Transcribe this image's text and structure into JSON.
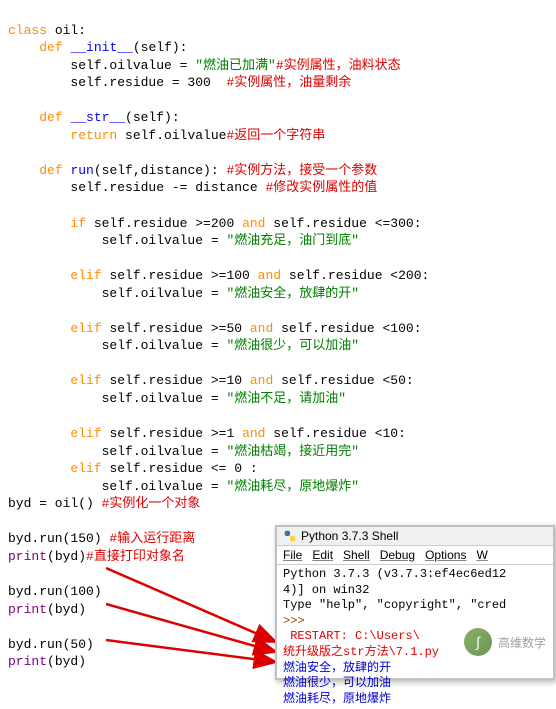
{
  "code": {
    "l1_kw": "class ",
    "l1_name": "oil:",
    "l2_kw": "def ",
    "l2_fn": "__init__",
    "l2_sig": "(self):",
    "l3_a": "        self.oilvalue = ",
    "l3_str": "\"燃油已加满\"",
    "l3_cmt": "#实例属性，油料状态",
    "l4_a": "        self.residue = 300  ",
    "l4_cmt": "#实例属性，油量剩余",
    "l5_kw": "def ",
    "l5_fn": "__str__",
    "l5_sig": "(self):",
    "l6_kw": "return ",
    "l6_a": "self.oilvalue",
    "l6_cmt": "#返回一个字符串",
    "l7_kw": "def ",
    "l7_fn": "run",
    "l7_sig": "(self,distance): ",
    "l7_cmt": "#实例方法，接受一个参数",
    "l8_a": "        self.residue -= distance ",
    "l8_cmt": "#修改实例属性的值",
    "l9_if": "if ",
    "l9_a": "self.residue >=200 ",
    "l9_and": "and ",
    "l9_b": "self.residue <=300:",
    "l10_a": "            self.oilvalue = ",
    "l10_str": "\"燃油充足，油门到底\"",
    "l11_if": "elif ",
    "l11_a": "self.residue >=100 ",
    "l11_and": "and ",
    "l11_b": "self.residue <200:",
    "l12_a": "            self.oilvalue = ",
    "l12_str": "\"燃油安全，放肆的开\"",
    "l13_if": "elif ",
    "l13_a": "self.residue >=50 ",
    "l13_and": "and ",
    "l13_b": "self.residue <100:",
    "l14_a": "            self.oilvalue = ",
    "l14_str": "\"燃油很少，可以加油\"",
    "l15_if": "elif ",
    "l15_a": "self.residue >=10 ",
    "l15_and": "and ",
    "l15_b": "self.residue <50:",
    "l16_a": "            self.oilvalue = ",
    "l16_str": "\"燃油不足，请加油\"",
    "l17_if": "elif ",
    "l17_a": "self.residue >=1 ",
    "l17_and": "and ",
    "l17_b": "self.residue <10:",
    "l18_a": "            self.oilvalue = ",
    "l18_str": "\"燃油枯竭，接近用完\"",
    "l19_if": "elif ",
    "l19_a": "self.residue <= 0 :",
    "l20_a": "            self.oilvalue = ",
    "l20_str": "\"燃油耗尽，原地爆炸\"",
    "l21_a": "byd = oil() ",
    "l21_cmt": "#实例化一个对象",
    "l22_a": "byd.run(150) ",
    "l22_cmt": "#输入运行距离",
    "l23_fn": "print",
    "l23_a": "(byd)",
    "l23_cmt": "#直接打印对象名",
    "l24_a": "byd.run(100)",
    "l25_fn": "print",
    "l25_a": "(byd)",
    "l26_a": "byd.run(50)",
    "l27_fn": "print",
    "l27_a": "(byd)"
  },
  "shell": {
    "title": "Python 3.7.3 Shell",
    "menu": {
      "file": "File",
      "edit": "Edit",
      "shell": "Shell",
      "debug": "Debug",
      "options": "Options",
      "w": "W"
    },
    "line1": "Python 3.7.3 (v3.7.3:ef4ec6ed12",
    "line2": "4)] on win32",
    "line3": "Type \"help\", \"copyright\", \"cred",
    "prompt": ">>> ",
    "restart": " RESTART: C:\\Users\\",
    "path2": "统升级版之str方法\\7.1.py",
    "out1": "燃油安全，放肆的开",
    "out2": "燃油很少，可以加油",
    "out3": "燃油耗尽，原地爆炸"
  },
  "watermark": {
    "text": "高维数学",
    "icon": "∫"
  }
}
